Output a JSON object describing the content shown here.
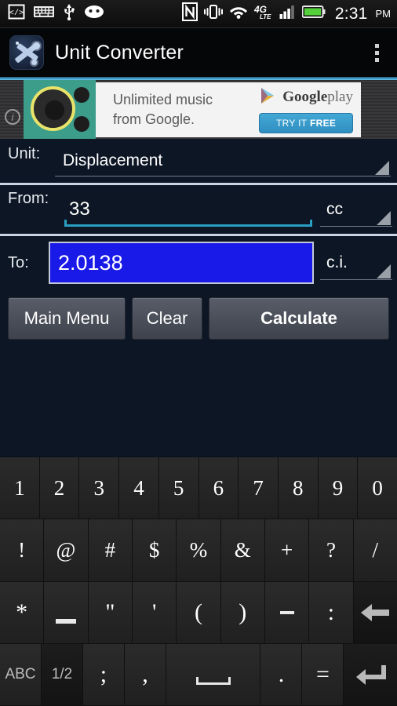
{
  "status_bar": {
    "left_icons": [
      "code-brackets-icon",
      "keyboard-icon",
      "usb-icon",
      "android-face-icon"
    ],
    "right_icons": [
      "nfc-icon",
      "vibrate-icon",
      "wifi-icon",
      "4g-lte-icon",
      "signal-bars-icon",
      "battery-icon"
    ],
    "network_label": "4G",
    "network_sub": "LTE",
    "time": "2:31",
    "ampm": "PM"
  },
  "action_bar": {
    "title": "Unit Converter",
    "app_icon": "wrench-tools-icon",
    "overflow_icon": "overflow-menu-icon",
    "accent_color": "#55b6e0"
  },
  "ad": {
    "info_icon": "info-icon",
    "artwork_icon": "speaker-record-icon",
    "headline_line1": "Unlimited music",
    "headline_line2": "from Google.",
    "brand_bold": "Google",
    "brand_light": "play",
    "brand_icon": "google-play-triangle-icon",
    "cta_strong": "TRY IT",
    "cta_light": "FREE",
    "cta_color": "#3b9ccd"
  },
  "form": {
    "unit": {
      "label": "Unit:",
      "value": "Displacement",
      "dropdown_icon": "spinner-triangle-icon"
    },
    "from": {
      "label": "From:",
      "value": "33",
      "unit_value": "cc",
      "dropdown_icon": "spinner-triangle-icon",
      "underline_color": "#2a9fc4"
    },
    "to": {
      "label": "To:",
      "value": "2.0138",
      "unit_value": "c.i.",
      "dropdown_icon": "spinner-triangle-icon",
      "highlight_color": "#1a1ae8"
    }
  },
  "buttons": {
    "main_menu": "Main Menu",
    "clear": "Clear",
    "calculate": "Calculate"
  },
  "keyboard": {
    "rows": [
      [
        {
          "label": "1",
          "name": "key-1"
        },
        {
          "label": "2",
          "name": "key-2"
        },
        {
          "label": "3",
          "name": "key-3"
        },
        {
          "label": "4",
          "name": "key-4"
        },
        {
          "label": "5",
          "name": "key-5"
        },
        {
          "label": "6",
          "name": "key-6"
        },
        {
          "label": "7",
          "name": "key-7"
        },
        {
          "label": "8",
          "name": "key-8"
        },
        {
          "label": "9",
          "name": "key-9"
        },
        {
          "label": "0",
          "name": "key-0"
        }
      ],
      [
        {
          "label": "!",
          "name": "key-exclamation"
        },
        {
          "label": "@",
          "name": "key-at"
        },
        {
          "label": "#",
          "name": "key-hash"
        },
        {
          "label": "$",
          "name": "key-dollar"
        },
        {
          "label": "%",
          "name": "key-percent"
        },
        {
          "label": "&",
          "name": "key-ampersand"
        },
        {
          "label": "+",
          "name": "key-plus"
        },
        {
          "label": "?",
          "name": "key-question"
        },
        {
          "label": "/",
          "name": "key-slash"
        }
      ],
      [
        {
          "label": "*",
          "name": "key-asterisk"
        },
        {
          "label": "_",
          "name": "key-underscore"
        },
        {
          "label": "\"",
          "name": "key-double-quote"
        },
        {
          "label": "'",
          "name": "key-single-quote"
        },
        {
          "label": "(",
          "name": "key-open-paren"
        },
        {
          "label": ")",
          "name": "key-close-paren"
        },
        {
          "label": "-",
          "name": "key-hyphen"
        },
        {
          "label": ":",
          "name": "key-colon"
        },
        {
          "label": "",
          "name": "key-backspace"
        }
      ],
      [
        {
          "label": "ABC",
          "name": "key-abc"
        },
        {
          "label": "1/2",
          "name": "key-page-toggle"
        },
        {
          "label": ";",
          "name": "key-semicolon"
        },
        {
          "label": ",",
          "name": "key-comma"
        },
        {
          "label": "",
          "name": "key-space"
        },
        {
          "label": ".",
          "name": "key-period"
        },
        {
          "label": "=",
          "name": "key-equals"
        },
        {
          "label": "",
          "name": "key-enter"
        }
      ]
    ]
  }
}
